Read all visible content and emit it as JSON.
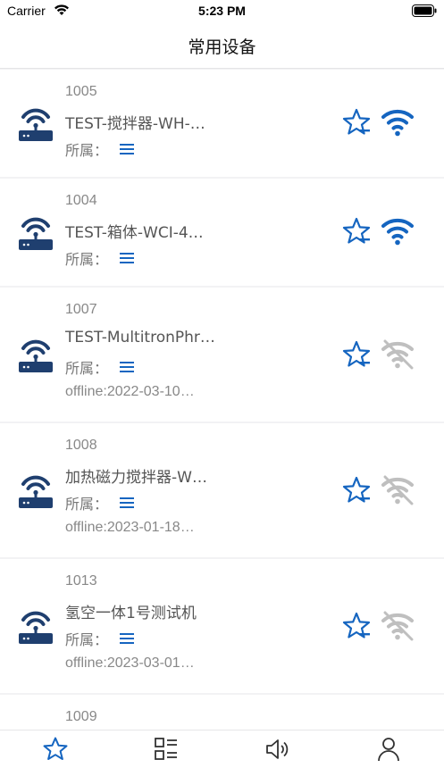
{
  "status_bar": {
    "carrier": "Carrier",
    "time": "5:23 PM"
  },
  "nav": {
    "title": "常用设备"
  },
  "colors": {
    "accent": "#1565c0",
    "icon_dark": "#1f3f6f",
    "offline_gray": "#bfbfbf"
  },
  "devices": [
    {
      "id": "1005",
      "name": "TEST-搅拌器-WH-…",
      "owner_label": "所属：",
      "online": true,
      "offline_text": ""
    },
    {
      "id": "1004",
      "name": "TEST-箱体-WCI-4…",
      "owner_label": "所属：",
      "online": true,
      "offline_text": ""
    },
    {
      "id": "1007",
      "name": "TEST-MultitronPhr…",
      "owner_label": "所属：",
      "online": false,
      "offline_text": "offline:2022-03-10…"
    },
    {
      "id": "1008",
      "name": "加热磁力搅拌器-W…",
      "owner_label": "所属：",
      "online": false,
      "offline_text": "offline:2023-01-18…"
    },
    {
      "id": "1013",
      "name": "氢空一体1号测试机",
      "owner_label": "所属：",
      "online": false,
      "offline_text": "offline:2023-03-01…"
    },
    {
      "id": "1009",
      "name": "",
      "owner_label": "",
      "online": false,
      "offline_text": ""
    }
  ],
  "tabs": [
    {
      "icon": "star-icon",
      "active": true
    },
    {
      "icon": "list-grid-icon",
      "active": false
    },
    {
      "icon": "speaker-icon",
      "active": false
    },
    {
      "icon": "person-icon",
      "active": false
    }
  ]
}
